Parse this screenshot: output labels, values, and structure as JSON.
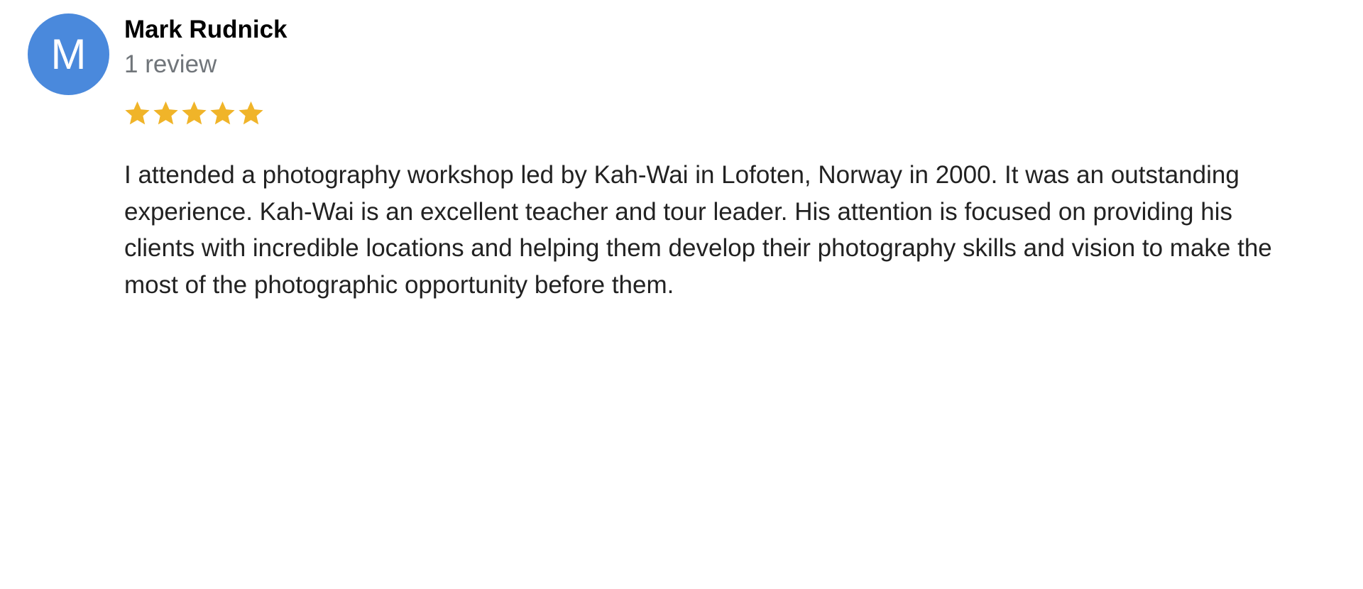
{
  "reviewer": {
    "avatar_letter": "M",
    "name": "Mark Rudnick",
    "review_count": "1 review"
  },
  "rating": {
    "stars": 5,
    "max": 5
  },
  "review": {
    "lines": [
      "I attended a photography workshop led by Kah-Wai in Lofoten, Norway in 2000. It was an outstanding",
      "experience. Kah-Wai is an excellent teacher and tour leader. His attention is focused on providing his",
      "clients with incredible locations and helping them develop their photography skills and vision to make the",
      "most of the photographic opportunity before them."
    ]
  },
  "colors": {
    "avatar_bg": "#4a89dc",
    "star": "#f0b429",
    "secondary_text": "#70757a"
  },
  "icons": {
    "star": "star-icon"
  }
}
